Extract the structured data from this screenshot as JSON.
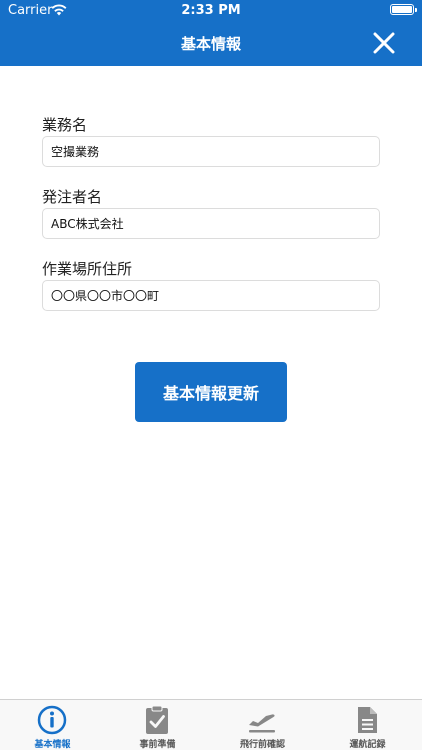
{
  "status_bar": {
    "carrier": "Carrier",
    "time": "2:33 PM"
  },
  "header": {
    "title": "基本情報",
    "close_icon": "close-icon"
  },
  "form": {
    "fields": [
      {
        "label": "業務名",
        "value": "空撮業務"
      },
      {
        "label": "発注者名",
        "value": "ABC株式会社"
      },
      {
        "label": "作業場所住所",
        "value": "〇〇県〇〇市〇〇町"
      }
    ],
    "submit_label": "基本情報更新"
  },
  "tabs": [
    {
      "label": "基本情報",
      "icon": "info-icon",
      "active": true
    },
    {
      "label": "事前準備",
      "icon": "clipboard-check-icon",
      "active": false
    },
    {
      "label": "飛行前確認",
      "icon": "airplane-takeoff-icon",
      "active": false
    },
    {
      "label": "運航記録",
      "icon": "document-icon",
      "active": false
    }
  ],
  "colors": {
    "primary": "#1670c8",
    "tab_inactive": "#888888"
  }
}
